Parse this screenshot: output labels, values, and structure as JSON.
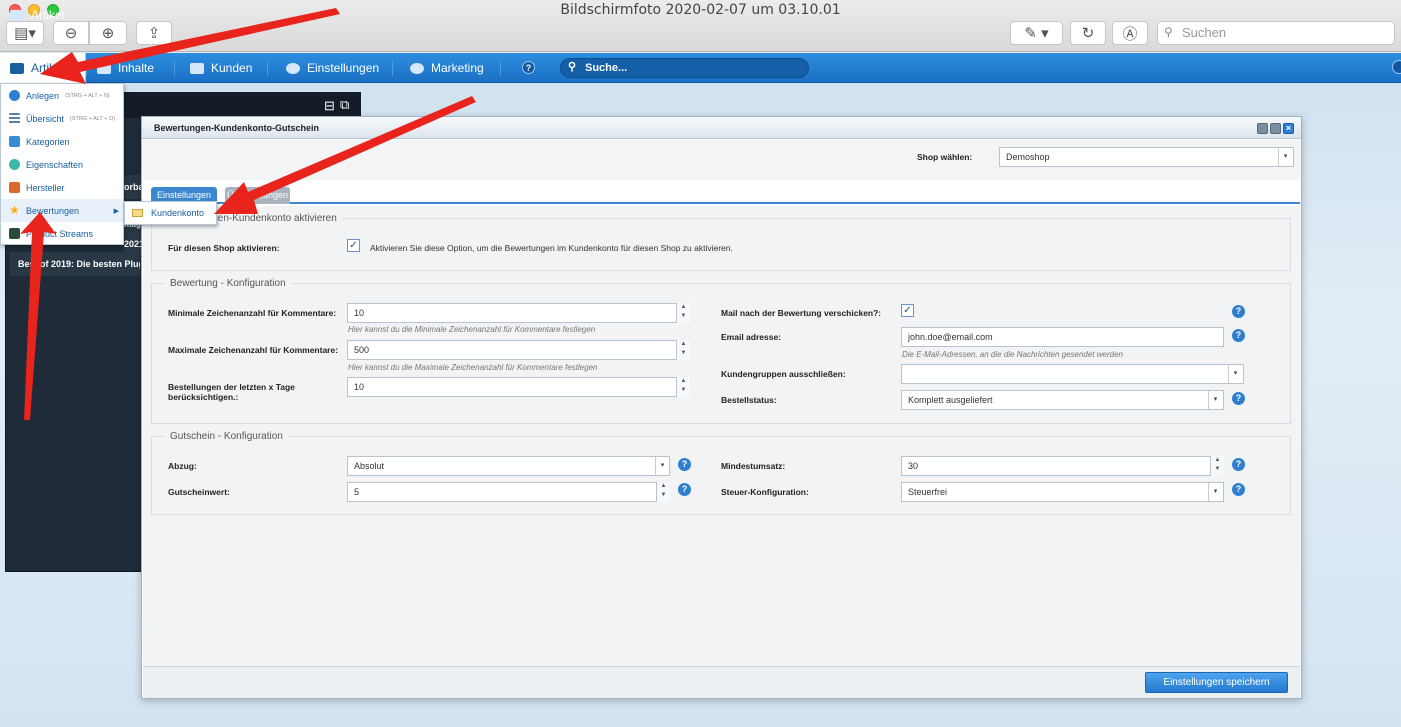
{
  "mac": {
    "window_title": "Bildschirmfoto 2020-02-07 um 03.10.01",
    "search_placeholder": "Suchen"
  },
  "menubar": {
    "items": [
      {
        "label": "Artikel",
        "icon": "box-icon"
      },
      {
        "label": "Inhalte",
        "icon": "content-icon"
      },
      {
        "label": "Kunden",
        "icon": "users-icon"
      },
      {
        "label": "Einstellungen",
        "icon": "gear-icon"
      },
      {
        "label": "Marketing",
        "icon": "pie-chart-icon"
      }
    ],
    "search_label": "Suche..."
  },
  "dropdown": {
    "items": [
      {
        "label": "Anlegen",
        "shortcut": "(STRG + ALT + N)",
        "icon": "plus-circle-icon"
      },
      {
        "label": "Übersicht",
        "shortcut": "(STRG + ALT + O)",
        "icon": "list-icon"
      },
      {
        "label": "Kategorien",
        "shortcut": "",
        "icon": "tree-icon"
      },
      {
        "label": "Eigenschaften",
        "shortcut": "",
        "icon": "share-icon"
      },
      {
        "label": "Hersteller",
        "shortcut": "",
        "icon": "factory-icon"
      },
      {
        "label": "Bewertungen",
        "shortcut": "",
        "icon": "star-icon"
      },
      {
        "label": "Product Streams",
        "shortcut": "",
        "icon": "stream-icon"
      }
    ],
    "submenu_item": "Kundenkonto"
  },
  "dark_panel": {
    "rows": [
      "orba",
      "2021",
      "ntag",
      "Best of 2019: Die besten Plugi"
    ]
  },
  "window": {
    "title": "Bewertungen-Kundenkonto-Gutschein",
    "shop_label": "Shop wählen:",
    "shop_value": "Demoshop",
    "tabs": [
      "Einstellungen",
      "Übersetzungen"
    ],
    "section1": {
      "legend": "Bewertungen-Kundenkonto aktivieren",
      "activate_label": "Für diesen Shop aktivieren:",
      "activate_text": "Aktivieren Sie diese Option, um die Bewertungen im Kundenkonto für diesen Shop zu aktivieren.",
      "activate_checked": true
    },
    "section2": {
      "legend": "Bewertung - Konfiguration",
      "min_label": "Minimale Zeichenanzahl für Kommentare:",
      "min_value": "10",
      "min_hint": "Hier kannst du die Minimale Zeichenanzahl für Kommentare festlegen",
      "max_label": "Maximale Zeichenanzahl für Kommentare:",
      "max_value": "500",
      "max_hint": "Hier kannst du die Maximale Zeichenanzahl für Kommentare festlegen",
      "orders_label_1": "Bestellungen der letzten x Tage",
      "orders_label_2": "berücksichtigen.:",
      "orders_value": "10",
      "mail_label": "Mail nach der Bewertung verschicken?:",
      "mail_checked": true,
      "email_label": "Email adresse:",
      "email_value": "john.doe@email.com",
      "email_hint": "Die E-Mail-Adressen, an die die Nachrichten gesendet werden",
      "groups_label": "Kundengruppen ausschließen:",
      "groups_value": "",
      "status_label": "Bestellstatus:",
      "status_value": "Komplett ausgeliefert"
    },
    "section3": {
      "legend": "Gutschein - Konfiguration",
      "abzug_label": "Abzug:",
      "abzug_value": "Absolut",
      "wert_label": "Gutscheinwert:",
      "wert_value": "5",
      "min_umsatz_label": "Mindestumsatz:",
      "min_umsatz_value": "30",
      "steuer_label": "Steuer-Konfiguration:",
      "steuer_value": "Steuerfrei"
    },
    "save_button": "Einstellungen speichern"
  },
  "colors": {
    "menubar": "#1f78cf",
    "accent": "#2f7fd0",
    "arrow": "#e8241c",
    "dark_panel": "#1f2b38"
  }
}
